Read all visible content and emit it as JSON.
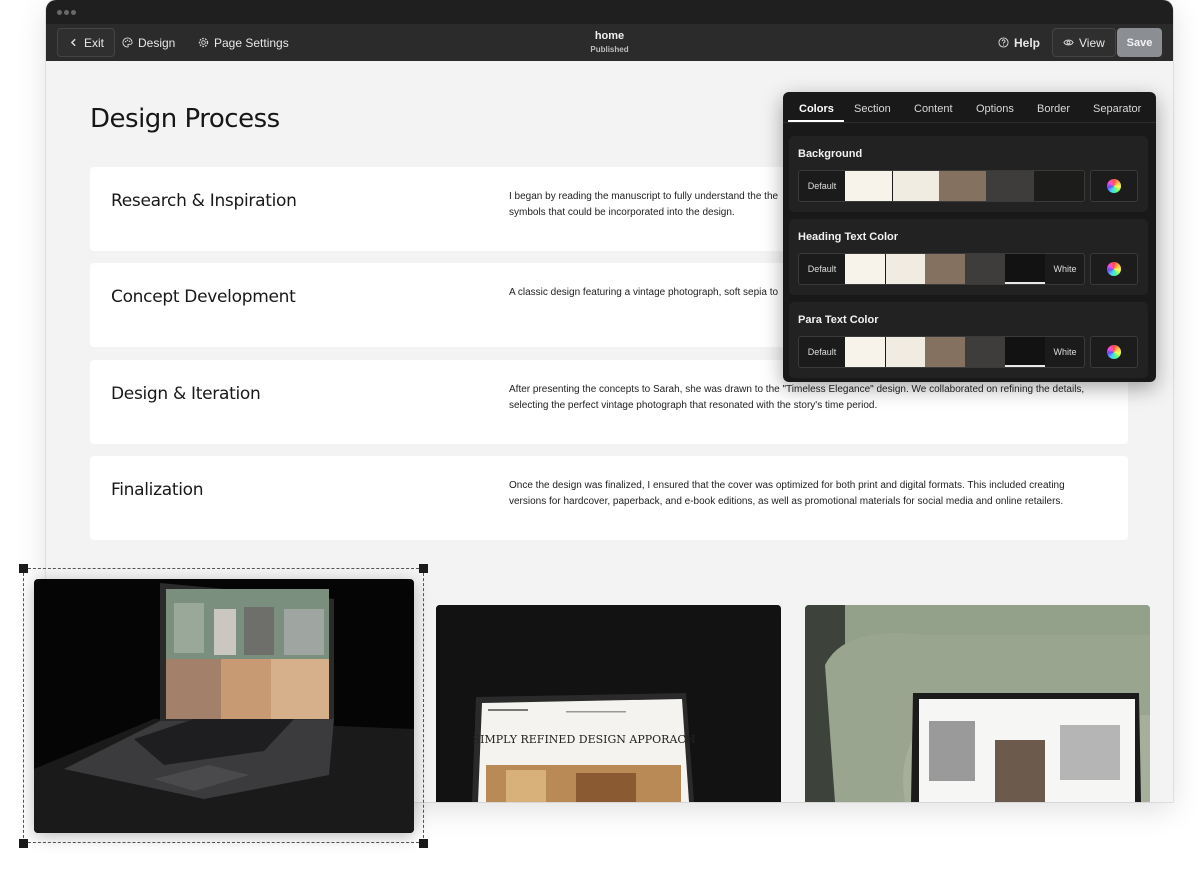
{
  "toolbar": {
    "exit_label": "Exit",
    "design_label": "Design",
    "page_settings_label": "Page Settings",
    "page_name": "home",
    "page_status": "Published",
    "help_label": "Help",
    "view_label": "View",
    "save_label": "Save"
  },
  "main": {
    "title": "Design Process",
    "steps": [
      {
        "title": "Research & Inspiration",
        "desc": "I began by reading the manuscript to fully understand the the\nsymbols that could be incorporated into the design."
      },
      {
        "title": "Concept Development",
        "desc": "A classic design featuring a vintage photograph, soft sepia to"
      },
      {
        "title": "Design & Iteration",
        "desc": "After presenting the concepts to Sarah, she was drawn to the \"Timeless Elegance\" design. We collaborated on refining the details,\nselecting the perfect vintage photograph that resonated with the story's time period."
      },
      {
        "title": "Finalization",
        "desc": "Once the design was finalized, I ensured that the cover was optimized for both print and digital formats. This included creating\nversions for hardcover, paperback, and e-book editions, as well as promotional materials for social media and online retailers."
      }
    ],
    "thumb2_text": "SIMPLY REFINED DESIGN APPORACH"
  },
  "panel": {
    "tabs": [
      "Colors",
      "Section",
      "Content",
      "Options",
      "Border",
      "Separator"
    ],
    "active_tab": "Colors",
    "groups": [
      {
        "label": "Background",
        "default_label": "Default",
        "end_label": "",
        "swatches": [
          "#f7f3ea",
          "#f1ece1",
          "#84715f",
          "#3e3d3b",
          "#1c1c1b"
        ],
        "selected_index": -1
      },
      {
        "label": "Heading Text Color",
        "default_label": "Default",
        "end_label": "White",
        "swatches": [
          "#f7f3ea",
          "#f1ece1",
          "#84715f",
          "#3e3d3b",
          "#121212"
        ],
        "selected_index": 4
      },
      {
        "label": "Para Text Color",
        "default_label": "Default",
        "end_label": "White",
        "swatches": [
          "#f7f3ea",
          "#f1ece1",
          "#84715f",
          "#3e3d3b",
          "#121212"
        ],
        "selected_index": 4
      }
    ],
    "wheel_icon": "color-wheel-icon"
  },
  "colors": {
    "toolbar_bg": "#2b2b2b",
    "panel_bg": "#191919",
    "save_bg": "#8b8f94"
  }
}
